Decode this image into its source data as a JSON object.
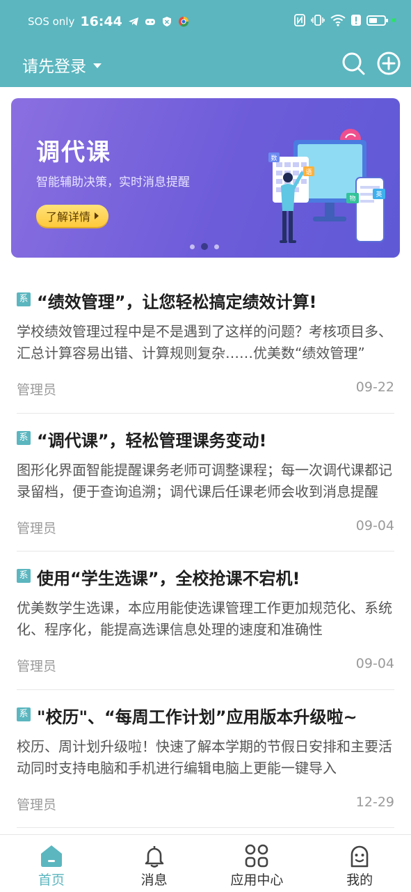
{
  "status_bar": {
    "carrier": "SOS only",
    "time": "16:44",
    "battery_level": 0.55
  },
  "header": {
    "login_label": "请先登录",
    "bg_color": "#5bb6bf"
  },
  "banner": {
    "title": "调代课",
    "subtitle": "智能辅助决策，实时消息提醒",
    "button_label": "了解详情",
    "illustration_labels": [
      "数",
      "语",
      "物",
      "英"
    ],
    "active_dot": 2,
    "dot_count": 3
  },
  "feed": [
    {
      "tag": "系",
      "title": "“绩效管理”，让您轻松搞定绩效计算!",
      "desc": "学校绩效管理过程中是不是遇到了这样的问题？考核项目多、汇总计算容易出错、计算规则复杂……优美数“绩效管理”",
      "author": "管理员",
      "date": "09-22"
    },
    {
      "tag": "系",
      "title": "“调代课”，轻松管理课务变动!",
      "desc": "图形化界面智能提醒课务老师可调整课程；每一次调代课都记录留档，便于查询追溯；调代课后任课老师会收到消息提醒",
      "author": "管理员",
      "date": "09-04"
    },
    {
      "tag": "系",
      "title": "使用“学生选课”，全校抢课不宕机!",
      "desc": "优美数学生选课，本应用能使选课管理工作更加规范化、系统化、程序化，能提高选课信息处理的速度和准确性",
      "author": "管理员",
      "date": "09-04"
    },
    {
      "tag": "系",
      "title": "\"校历\"、“每周工作计划”应用版本升级啦~",
      "desc": "校历、周计划升级啦！快速了解本学期的节假日安排和主要活动同时支持电脑和手机进行编辑电脑上更能一键导入",
      "author": "管理员",
      "date": "12-29"
    }
  ],
  "tabbar": {
    "tabs": [
      {
        "label": "首页",
        "icon": "home-icon",
        "active": true
      },
      {
        "label": "消息",
        "icon": "bell-icon",
        "active": false
      },
      {
        "label": "应用中心",
        "icon": "apps-grid-icon",
        "active": false
      },
      {
        "label": "我的",
        "icon": "profile-icon",
        "active": false
      }
    ],
    "active_color": "#5bb6bf"
  }
}
